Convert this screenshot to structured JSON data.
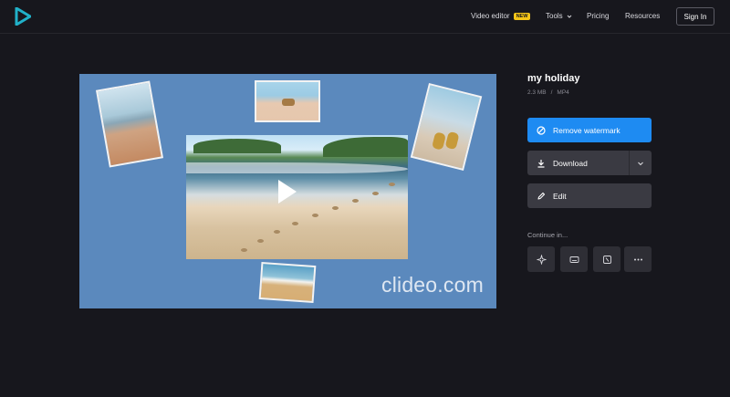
{
  "header": {
    "nav": {
      "video_editor": "Video editor",
      "new_badge": "NEW",
      "tools": "Tools",
      "pricing": "Pricing",
      "resources": "Resources"
    },
    "sign_in": "Sign In"
  },
  "preview": {
    "watermark": "clideo.com",
    "background_color": "#5b89bd"
  },
  "file": {
    "title": "my holiday",
    "size": "2.3 MB",
    "separator": "/",
    "format": "MP4"
  },
  "actions": {
    "remove_watermark": "Remove watermark",
    "download": "Download",
    "edit": "Edit"
  },
  "continue_in": {
    "label": "Continue in...",
    "icons": [
      "sparkle-icon",
      "subtitles-icon",
      "crop-icon",
      "more-icon"
    ]
  },
  "colors": {
    "accent": "#1e8bf2",
    "background": "#17171d",
    "badge": "#f5c518"
  }
}
